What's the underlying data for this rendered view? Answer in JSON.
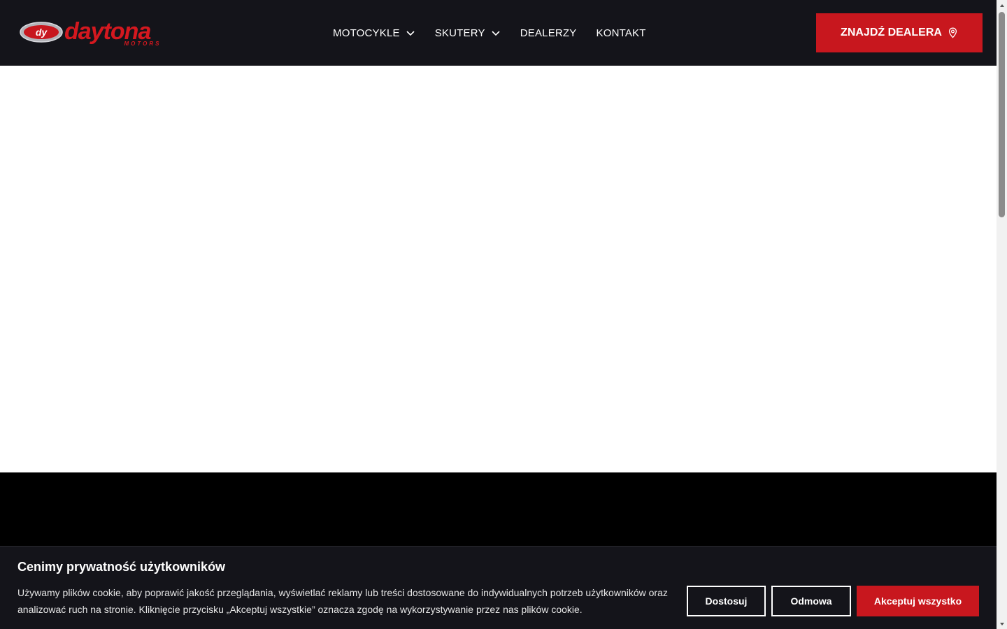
{
  "header": {
    "logo": {
      "text": "daytona",
      "subtext": "MOTORS",
      "emblem": "dy"
    },
    "nav": [
      {
        "label": "MOTOCYKLE",
        "dropdown": true
      },
      {
        "label": "SKUTERY",
        "dropdown": true
      },
      {
        "label": "DEALERZY",
        "dropdown": false
      },
      {
        "label": "KONTAKT",
        "dropdown": false
      }
    ],
    "cta": {
      "label": "ZNAJDŹ DEALERA",
      "icon": "map-pin-icon"
    }
  },
  "cookie_banner": {
    "title": "Cenimy prywatność użytkowników",
    "text": "Używamy plików cookie, aby poprawić jakość przeglądania, wyświetlać reklamy lub treści dostosowane do indywidualnych potrzeb użytkowników oraz analizować ruch na stronie. Kliknięcie przycisku „Akceptuj wszystkie” oznacza zgodę na wykorzystywanie przez nas plików cookie.",
    "buttons": {
      "customize": "Dostosuj",
      "reject": "Odmowa",
      "accept": "Akceptuj wszystko"
    }
  },
  "colors": {
    "header_bg": "#14141a",
    "accent_red": "#c8171e",
    "text_white": "#ffffff",
    "footer_black": "#000000"
  }
}
